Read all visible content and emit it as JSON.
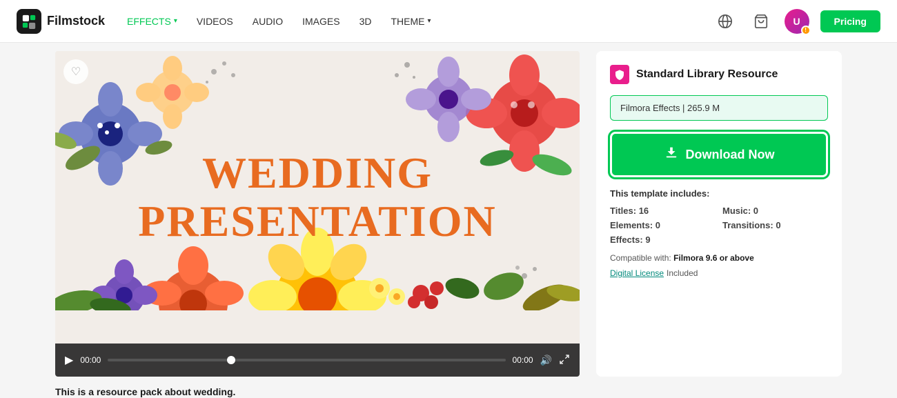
{
  "navbar": {
    "logo_text": "Filmstock",
    "links": [
      {
        "label": "EFFECTS",
        "active": true,
        "hasChevron": true
      },
      {
        "label": "VIDEOS",
        "active": false,
        "hasChevron": false
      },
      {
        "label": "AUDIO",
        "active": false,
        "hasChevron": false
      },
      {
        "label": "IMAGES",
        "active": false,
        "hasChevron": false
      },
      {
        "label": "3D",
        "active": false,
        "hasChevron": false
      },
      {
        "label": "THEME",
        "active": false,
        "hasChevron": true
      }
    ],
    "pricing_label": "Pricing"
  },
  "video": {
    "title_line1": "WEDDING",
    "title_line2": "PRESENTATION",
    "heart_icon": "♡",
    "play_icon": "▶",
    "time_start": "00:00",
    "time_end": "00:00",
    "volume_icon": "🔊",
    "fullscreen_icon": "⛶"
  },
  "sidebar": {
    "resource_label": "Standard Library Resource",
    "file_label": "Filmora Effects | 265.9 M",
    "download_label": "Download Now",
    "includes_title": "This template includes:",
    "titles_label": "Titles:",
    "titles_value": "16",
    "music_label": "Music:",
    "music_value": "0",
    "elements_label": "Elements:",
    "elements_value": "0",
    "transitions_label": "Transitions:",
    "transitions_value": "0",
    "effects_label": "Effects:",
    "effects_value": "9",
    "compatible_label": "Compatible with:",
    "compatible_value": "Filmora 9.6 or above",
    "license_link_label": "Digital License",
    "license_suffix": " Included"
  },
  "description": "This is a resource pack about wedding."
}
